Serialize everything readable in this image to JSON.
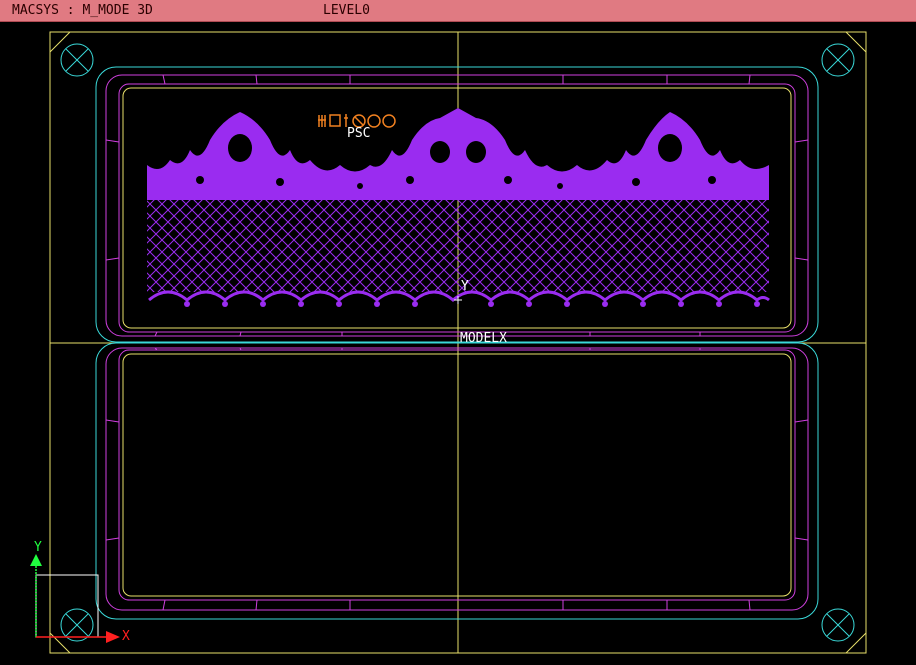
{
  "titlebar": {
    "system": "MACSYS : M_MODE 3D",
    "level": "LEVEL0"
  },
  "viewport": {
    "model_label": "MODELX",
    "origin_label": "Y",
    "axis_x_label": "X",
    "axis_y_label": "Y",
    "design_mark": "PSC"
  },
  "colors": {
    "frame": "#e8e06a",
    "cyan": "#3ad9d9",
    "magenta": "#d040e0",
    "pattern": "#9a2cf0",
    "orange": "#f08020",
    "axis_x": "#ff2020",
    "axis_y": "#20ff40"
  },
  "icons": [
    "corner-bolt-icon",
    "plus-origin-icon"
  ]
}
